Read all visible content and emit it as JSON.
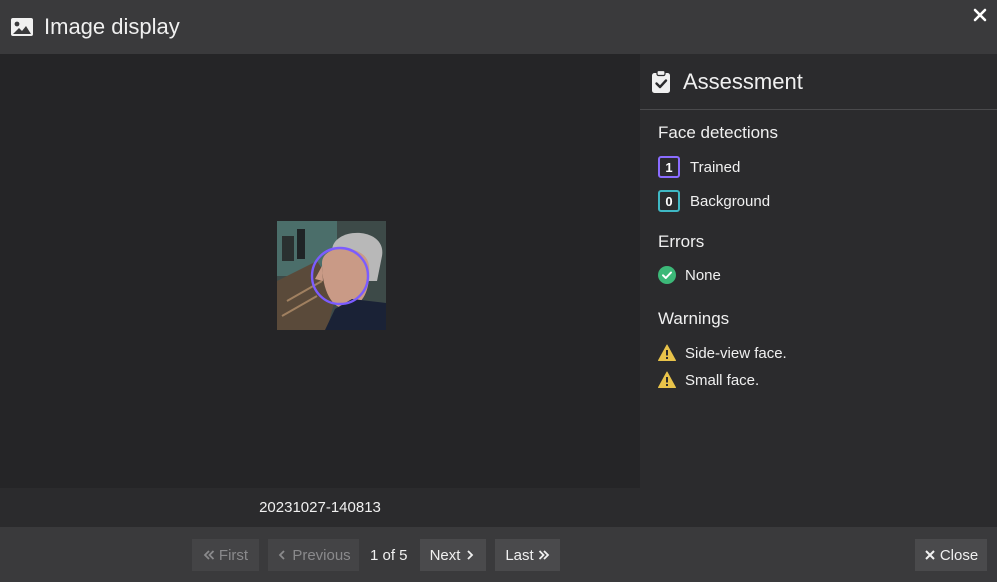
{
  "header": {
    "title": "Image display",
    "title_icon": "image-icon",
    "close_icon": "close-icon"
  },
  "image": {
    "caption": "20231027-140813",
    "detection_ring_color": "#7b5cff"
  },
  "assessment": {
    "title": "Assessment",
    "icon": "clipboard-check-icon",
    "face_detections": {
      "heading": "Face detections",
      "items": [
        {
          "count": "1",
          "label": "Trained",
          "color": "#8a6cff"
        },
        {
          "count": "0",
          "label": "Background",
          "color": "#3fb8c4"
        }
      ]
    },
    "errors": {
      "heading": "Errors",
      "items": [
        {
          "label": "None",
          "icon": "check-circle-icon",
          "color": "#3cb878"
        }
      ]
    },
    "warnings": {
      "heading": "Warnings",
      "items": [
        {
          "label": "Side-view face.",
          "icon": "warning-icon",
          "color": "#e8c34a"
        },
        {
          "label": "Small face.",
          "icon": "warning-icon",
          "color": "#e8c34a"
        }
      ]
    }
  },
  "footer": {
    "first_label": "First",
    "previous_label": "Previous",
    "page_indicator": "1 of 5",
    "next_label": "Next",
    "last_label": "Last",
    "close_label": "Close"
  }
}
